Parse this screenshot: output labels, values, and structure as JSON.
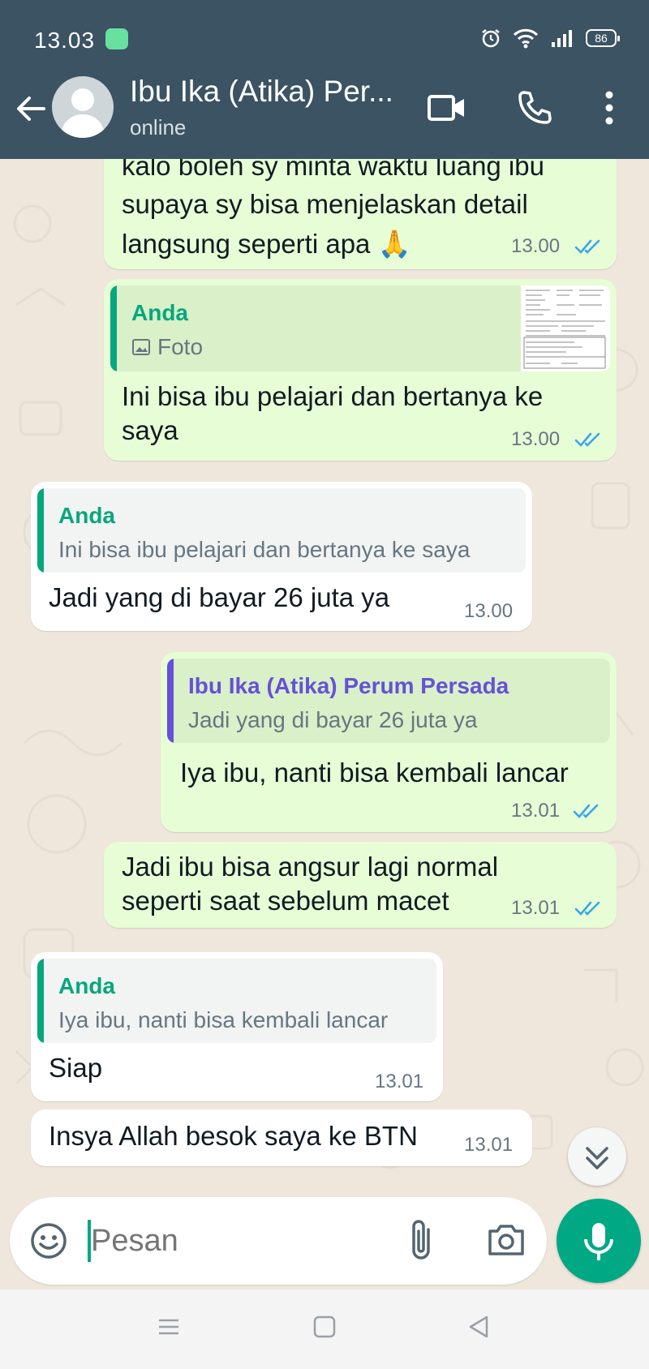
{
  "status_bar": {
    "time": "13.03",
    "battery": "86"
  },
  "header": {
    "contact_name": "Ibu Ika (Atika) Per...",
    "status": "online"
  },
  "messages": [
    {
      "type": "out",
      "text_lines": [
        "kalo boleh sy minta waktu luang ibu",
        "supaya sy bisa menjelaskan detail",
        "langsung seperti apa 🙏"
      ],
      "time": "13.00"
    },
    {
      "type": "out",
      "reply_name": "Anda",
      "reply_text": "Foto",
      "text_lines": [
        "Ini bisa ibu pelajari dan bertanya ke",
        "saya"
      ],
      "time": "13.00"
    },
    {
      "type": "in",
      "reply_name": "Anda",
      "reply_text": "Ini bisa ibu pelajari dan bertanya ke saya",
      "text_lines": [
        "Jadi yang di bayar 26 juta ya"
      ],
      "time": "13.00"
    },
    {
      "type": "out",
      "reply_name": "Ibu Ika (Atika) Perum Persada",
      "reply_text": "Jadi yang di bayar 26 juta ya",
      "text_lines": [
        "Iya ibu, nanti bisa kembali lancar"
      ],
      "time": "13.01"
    },
    {
      "type": "out",
      "text_lines": [
        "Jadi ibu bisa angsur lagi normal",
        "seperti saat sebelum macet"
      ],
      "time": "13.01"
    },
    {
      "type": "in",
      "reply_name": "Anda",
      "reply_text": "Iya ibu, nanti bisa kembali lancar",
      "text_lines": [
        "Siap"
      ],
      "time": "13.01"
    },
    {
      "type": "in",
      "text_lines": [
        "Insya Allah besok saya ke BTN"
      ],
      "time": "13.01"
    }
  ],
  "composer": {
    "placeholder": "Pesan"
  },
  "colors": {
    "header": "#3b5362",
    "outgoing": "#e7fdd6",
    "incoming": "#ffffff",
    "accent": "#00a884",
    "reply_you": "#06a77d",
    "reply_contact": "#6551d6",
    "read_ticks": "#3aa6e8"
  },
  "icons": [
    "back-arrow-icon",
    "avatar-icon",
    "video-call-icon",
    "phone-icon",
    "more-vert-icon",
    "image-icon",
    "double-check-icon",
    "scroll-down-icon",
    "emoji-icon",
    "attach-icon",
    "camera-icon",
    "mic-icon",
    "nav-menu-icon",
    "nav-home-icon",
    "nav-back-icon"
  ]
}
